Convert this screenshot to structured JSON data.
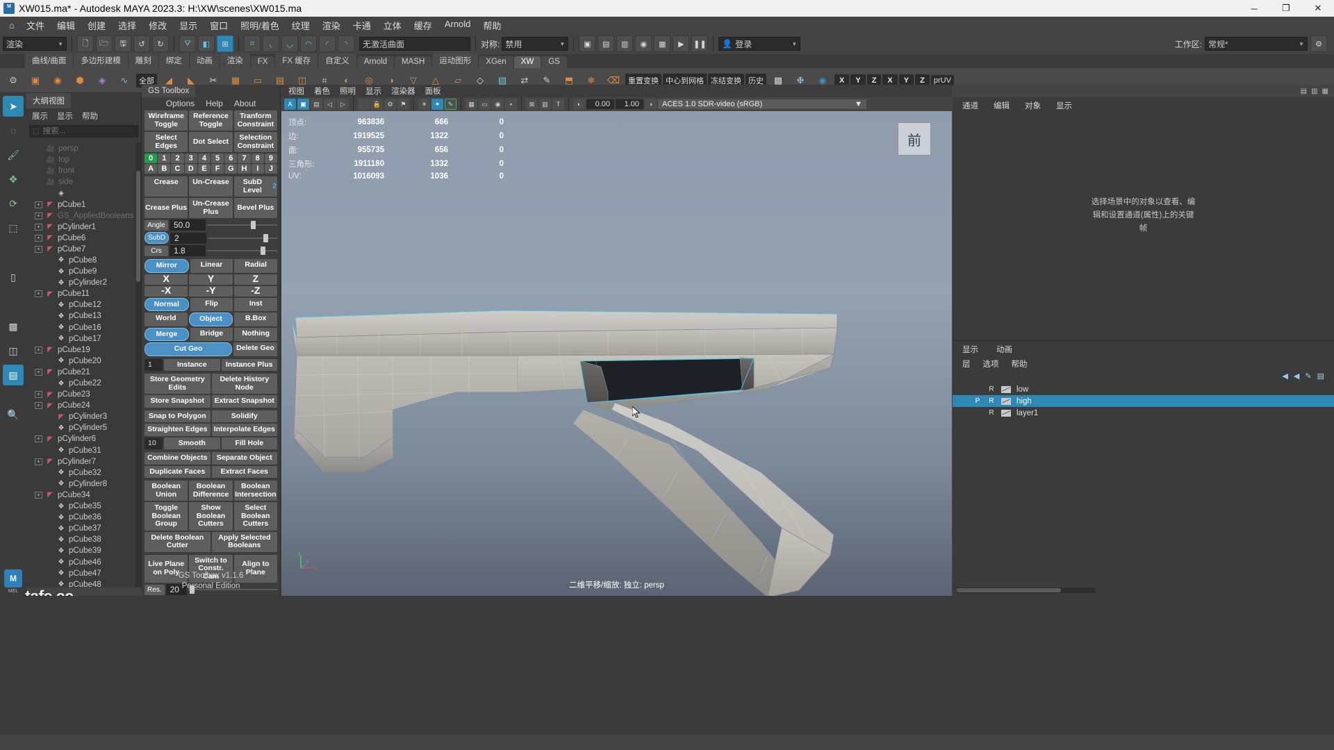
{
  "titlebar": {
    "title": "XW015.ma* - Autodesk MAYA 2023.3: H:\\XW\\scenes\\XW015.ma",
    "app_badge": "M",
    "minimize": "─",
    "maximize": "❐",
    "close": "✕"
  },
  "menubar": {
    "home_icon": "⌂",
    "items": [
      "文件",
      "编辑",
      "创建",
      "选择",
      "修改",
      "显示",
      "窗口",
      "照明/着色",
      "纹理",
      "渲染",
      "卡通",
      "立体",
      "缓存",
      "Arnold",
      "帮助"
    ]
  },
  "statusline": {
    "mode_value": "渲染",
    "curve_value": "无激活曲面",
    "symmetry_label": "对称:",
    "symmetry_value": "禁用",
    "login_label": "登录",
    "workspace_label": "工作区:",
    "workspace_value": "常规*"
  },
  "shelf": {
    "tabs": [
      "曲线/曲面",
      "多边形建模",
      "雕刻",
      "绑定",
      "动画",
      "渲染",
      "FX",
      "FX 缓存",
      "自定义",
      "Arnold",
      "MASH",
      "运动图形",
      "XGen",
      "XW",
      "GS"
    ],
    "active_tab": "XW",
    "all_label": "全部",
    "axis_labels": [
      "X",
      "Y",
      "Z",
      "X",
      "Y",
      "Z"
    ],
    "pruv_label": "prUV",
    "center_pivot_label": "重置变换",
    "center_label": "中心到网格",
    "freeze_label": "冻结变换",
    "history_label": "历史"
  },
  "outliner": {
    "tab": "大纲视图",
    "menu": [
      "展示",
      "显示",
      "帮助"
    ],
    "search_placeholder": "搜索...",
    "items": [
      {
        "label": "persp",
        "type": "camera",
        "indent": 1,
        "expand": false,
        "state": "dim"
      },
      {
        "label": "top",
        "type": "camera",
        "indent": 1,
        "expand": false,
        "state": "dim"
      },
      {
        "label": "front",
        "type": "camera",
        "indent": 1,
        "expand": false,
        "state": "dim"
      },
      {
        "label": "side",
        "type": "camera",
        "indent": 1,
        "expand": false,
        "state": "dim"
      },
      {
        "label": "",
        "type": "green",
        "indent": 1,
        "expand": false,
        "state": "green"
      },
      {
        "label": "pCube1",
        "type": "mesh",
        "indent": 0,
        "expand": true,
        "state": "normal"
      },
      {
        "label": "GS_AppliedBooleans",
        "type": "mesh",
        "indent": 0,
        "expand": true,
        "state": "dim"
      },
      {
        "label": "pCylinder1",
        "type": "mesh",
        "indent": 0,
        "expand": true,
        "state": "normal"
      },
      {
        "label": "pCube6",
        "type": "mesh",
        "indent": 0,
        "expand": true,
        "state": "normal"
      },
      {
        "label": "pCube7",
        "type": "mesh",
        "indent": 0,
        "expand": true,
        "state": "normal"
      },
      {
        "label": "pCube8",
        "type": "poly",
        "indent": 1,
        "expand": false,
        "state": "normal"
      },
      {
        "label": "pCube9",
        "type": "poly",
        "indent": 1,
        "expand": false,
        "state": "normal"
      },
      {
        "label": "pCylinder2",
        "type": "poly",
        "indent": 1,
        "expand": false,
        "state": "normal"
      },
      {
        "label": "pCube11",
        "type": "mesh",
        "indent": 0,
        "expand": true,
        "state": "normal"
      },
      {
        "label": "pCube12",
        "type": "poly",
        "indent": 1,
        "expand": false,
        "state": "normal"
      },
      {
        "label": "pCube13",
        "type": "poly",
        "indent": 1,
        "expand": false,
        "state": "normal"
      },
      {
        "label": "pCube16",
        "type": "poly",
        "indent": 1,
        "expand": false,
        "state": "normal"
      },
      {
        "label": "pCube17",
        "type": "poly",
        "indent": 1,
        "expand": false,
        "state": "normal"
      },
      {
        "label": "pCube19",
        "type": "mesh",
        "indent": 0,
        "expand": true,
        "state": "normal"
      },
      {
        "label": "pCube20",
        "type": "poly",
        "indent": 1,
        "expand": false,
        "state": "normal"
      },
      {
        "label": "pCube21",
        "type": "mesh",
        "indent": 0,
        "expand": true,
        "state": "normal"
      },
      {
        "label": "pCube22",
        "type": "poly",
        "indent": 1,
        "expand": false,
        "state": "normal"
      },
      {
        "label": "pCube23",
        "type": "mesh",
        "indent": 0,
        "expand": true,
        "state": "normal"
      },
      {
        "label": "pCube24",
        "type": "mesh",
        "indent": 0,
        "expand": true,
        "state": "normal"
      },
      {
        "label": "pCylinder3",
        "type": "mesh",
        "indent": 1,
        "expand": false,
        "state": "normal"
      },
      {
        "label": "pCylinder5",
        "type": "poly",
        "indent": 1,
        "expand": false,
        "state": "normal"
      },
      {
        "label": "pCylinder6",
        "type": "mesh",
        "indent": 0,
        "expand": true,
        "state": "normal"
      },
      {
        "label": "pCube31",
        "type": "poly",
        "indent": 1,
        "expand": false,
        "state": "normal"
      },
      {
        "label": "pCylinder7",
        "type": "mesh",
        "indent": 0,
        "expand": true,
        "state": "normal"
      },
      {
        "label": "pCube32",
        "type": "poly",
        "indent": 1,
        "expand": false,
        "state": "normal"
      },
      {
        "label": "pCylinder8",
        "type": "poly",
        "indent": 1,
        "expand": false,
        "state": "normal"
      },
      {
        "label": "pCube34",
        "type": "mesh",
        "indent": 0,
        "expand": true,
        "state": "normal"
      },
      {
        "label": "pCube35",
        "type": "poly",
        "indent": 1,
        "expand": false,
        "state": "normal"
      },
      {
        "label": "pCube36",
        "type": "poly",
        "indent": 1,
        "expand": false,
        "state": "normal"
      },
      {
        "label": "pCube37",
        "type": "poly",
        "indent": 1,
        "expand": false,
        "state": "normal"
      },
      {
        "label": "pCube38",
        "type": "poly",
        "indent": 1,
        "expand": false,
        "state": "normal"
      },
      {
        "label": "pCube39",
        "type": "poly",
        "indent": 1,
        "expand": false,
        "state": "normal"
      },
      {
        "label": "pCube46",
        "type": "poly",
        "indent": 1,
        "expand": false,
        "state": "normal"
      },
      {
        "label": "pCube47",
        "type": "poly",
        "indent": 1,
        "expand": false,
        "state": "normal"
      },
      {
        "label": "pCube48",
        "type": "poly",
        "indent": 1,
        "expand": false,
        "state": "normal"
      }
    ]
  },
  "gs_toolbox": {
    "tab": "GS Toolbox",
    "menu": [
      "Options",
      "Help",
      "About"
    ],
    "row_wireframe": [
      "Wireframe Toggle",
      "Reference Toggle",
      "Tranform Constraint"
    ],
    "row_select": [
      "Select Edges",
      "Dot Select",
      "Selection Constraint"
    ],
    "numbers": [
      "0",
      "1",
      "2",
      "3",
      "4",
      "5",
      "6",
      "7",
      "8",
      "9"
    ],
    "letters": [
      "A",
      "B",
      "C",
      "D",
      "E",
      "F",
      "G",
      "H",
      "I",
      "J"
    ],
    "active_number": "0",
    "row_crease": [
      "Crease",
      "Un-Crease",
      "SubD Level"
    ],
    "subd_level_value": "2",
    "row_crease_plus": [
      "Crease Plus",
      "Un-Crease Plus",
      "Bevel Plus"
    ],
    "angle_label": "Angle",
    "angle_value": "50.0",
    "subd_label": "SubD",
    "subd_value": "2",
    "crs_label": "Crs",
    "crs_value": "1.8",
    "row_mirror": [
      "Mirror",
      "Linear",
      "Radial"
    ],
    "row_axis_pos": [
      "X",
      "Y",
      "Z"
    ],
    "row_axis_neg": [
      "-X",
      "-Y",
      "-Z"
    ],
    "row_normal": [
      "Normal",
      "Flip",
      "Inst"
    ],
    "row_world": [
      "World",
      "Object",
      "B.Box"
    ],
    "row_merge": [
      "Merge",
      "Bridge",
      "Nothing"
    ],
    "cut_geo": "Cut Geo",
    "delete_geo": "Delete Geo",
    "instance_count": "1",
    "row_instance": [
      "Instance",
      "Instance Plus"
    ],
    "row_store": [
      "Store Geometry Edits",
      "Delete History Node"
    ],
    "row_snapshot": [
      "Store Snapshot",
      "Extract Snapshot"
    ],
    "row_snap": [
      "Snap to Polygon",
      "Solidify"
    ],
    "row_straighten": [
      "Straighten Edges",
      "Interpolate Edges"
    ],
    "smooth_count": "10",
    "row_smooth": [
      "Smooth",
      "Fill Hole"
    ],
    "row_combine": [
      "Combine Objects",
      "Separate Object"
    ],
    "row_dup": [
      "Duplicate Faces",
      "Extract Faces"
    ],
    "row_bool1": [
      "Boolean Union",
      "Boolean Difference",
      "Boolean Intersection"
    ],
    "row_bool2": [
      "Toggle Boolean Group",
      "Show Boolean Cutters",
      "Select Boolean Cutters"
    ],
    "row_bool3": [
      "Delete Boolean Cutter",
      "Apply Selected Booleans"
    ],
    "row_live": [
      "Live Plane on Poly",
      "Switch to Constr. Cam",
      "Align to Plane"
    ],
    "res_label": "Res.",
    "res_value": "20",
    "footer_line1": "GS Toolbox v1.1.6",
    "footer_line2": "Personal Edition"
  },
  "viewport": {
    "menu": [
      "视图",
      "着色",
      "照明",
      "显示",
      "渲染器",
      "面板"
    ],
    "exposure_value": "0.00",
    "gamma_value": "1.00",
    "color_profile": "ACES 1.0 SDR-video (sRGB)",
    "viewcube_label": "前",
    "axis_x": "x",
    "axis_y": "y",
    "axis_z": "z",
    "footer": "二维平移/缩放: 独立: persp",
    "hud": {
      "columns_note": "",
      "rows": [
        {
          "label": "顶点:",
          "c1": "963836",
          "c2": "666",
          "c3": "0"
        },
        {
          "label": "边:",
          "c1": "1919525",
          "c2": "1322",
          "c3": "0"
        },
        {
          "label": "面:",
          "c1": "955735",
          "c2": "656",
          "c3": "0"
        },
        {
          "label": "三角形:",
          "c1": "1911180",
          "c2": "1332",
          "c3": "0"
        },
        {
          "label": "UV:",
          "c1": "1016093",
          "c2": "1036",
          "c3": "0"
        }
      ]
    }
  },
  "right_panel": {
    "menu": [
      "通道",
      "编辑",
      "对象",
      "显示"
    ],
    "message": "选择场景中的对象以查看、编\n辑和设置通道(属性)上的关键\n帧",
    "layers": {
      "tabs": [
        "显示",
        "动画"
      ],
      "menu": [
        "层",
        "选项",
        "帮助"
      ],
      "rows": [
        {
          "v": "",
          "p": "",
          "r": "R",
          "name": "low",
          "selected": false
        },
        {
          "v": "",
          "p": "P",
          "r": "R",
          "name": "high",
          "selected": true
        },
        {
          "v": "",
          "p": "",
          "r": "R",
          "name": "layer1",
          "selected": false
        }
      ]
    }
  }
}
